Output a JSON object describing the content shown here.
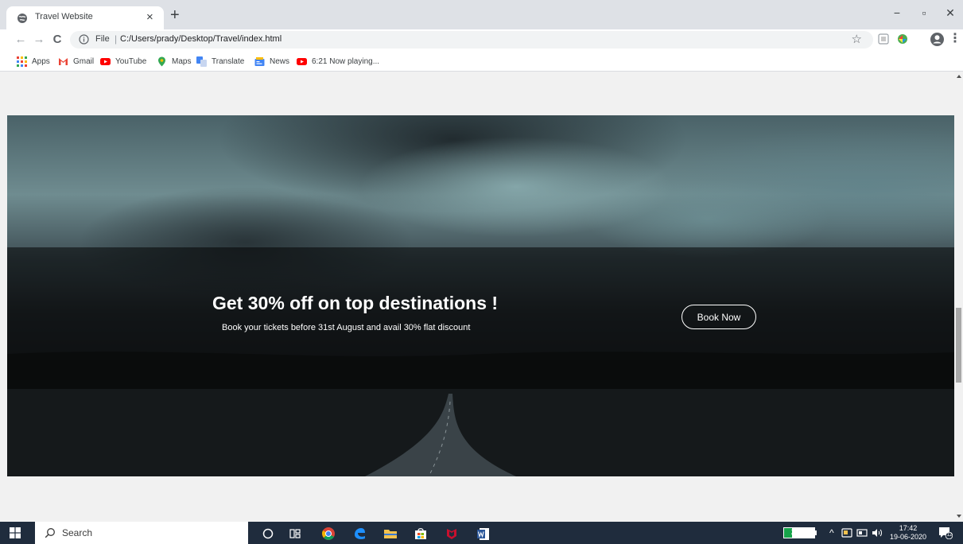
{
  "browser": {
    "tab": {
      "title": "Travel Website",
      "close_glyph": "×"
    },
    "new_tab_glyph": "+",
    "window_controls": {
      "minimize": "−",
      "maximize": "▫",
      "close": "✕"
    },
    "nav": {
      "back": "←",
      "forward": "→",
      "reload": "C"
    },
    "address": {
      "scheme": "File",
      "separator": "|",
      "url": "C:/Users/prady/Desktop/Travel/index.html",
      "star": "☆"
    },
    "menu_glyph": "⋮",
    "bookmarks": [
      {
        "label": "Apps",
        "icon": "apps-grid-icon"
      },
      {
        "label": "Gmail",
        "icon": "gmail-icon"
      },
      {
        "label": "YouTube",
        "icon": "youtube-icon"
      },
      {
        "label": "Maps",
        "icon": "maps-icon"
      },
      {
        "label": "Translate",
        "icon": "translate-icon"
      },
      {
        "label": "News",
        "icon": "news-icon"
      },
      {
        "label": "6:21 Now playing...",
        "icon": "youtube-icon"
      }
    ]
  },
  "page": {
    "banner": {
      "headline": "Get 30% off on top destinations !",
      "subline": "Book your tickets before 31st August and avail 30% flat discount",
      "cta": "Book Now"
    }
  },
  "taskbar": {
    "search_placeholder": "Search",
    "battery": {
      "text": "27%",
      "level": 0.27
    },
    "clock": {
      "time": "17:42",
      "date": "19-06-2020"
    },
    "notification_count": "12",
    "tray_chevron": "^"
  },
  "colors": {
    "tab_strip": "#dee1e6",
    "taskbar": "#1f2c3d",
    "battery_green": "#16a34a",
    "banner_overlay": "rgba(0,0,0,0.52)"
  }
}
